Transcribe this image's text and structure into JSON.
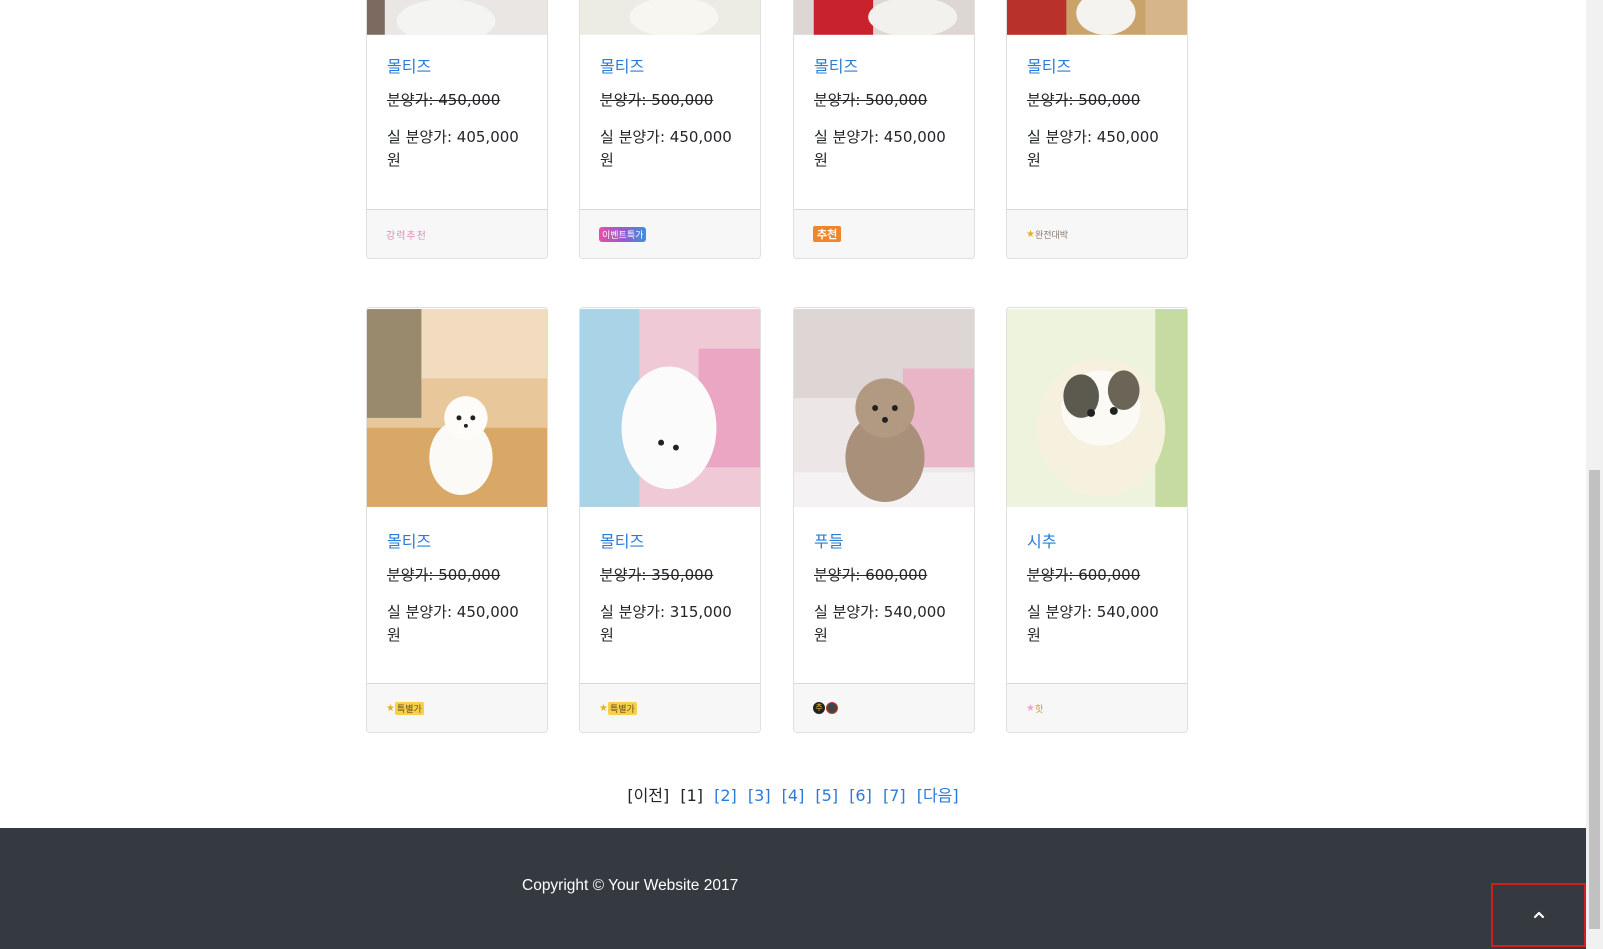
{
  "colors": {
    "link": "#2b7bd6",
    "footer_bg": "#343a40",
    "card_footer_bg": "#f7f7f7",
    "highlight_border": "#d11f1f"
  },
  "cards_row1": [
    {
      "name": "몰티즈",
      "original_price": "분양가: 450,000",
      "real_price": "실 분양가: 405,000 원",
      "badge": "강력추천",
      "badge_icon": "strong-recommend-badge-icon"
    },
    {
      "name": "몰티즈",
      "original_price": "분양가: 500,000",
      "real_price": "실 분양가: 450,000 원",
      "badge": "이벤트특가",
      "badge_icon": "event-badge-icon"
    },
    {
      "name": "몰티즈",
      "original_price": "분양가: 500,000",
      "real_price": "실 분양가: 450,000 원",
      "badge": "추천",
      "badge_icon": "recommend-badge-icon"
    },
    {
      "name": "몰티즈",
      "original_price": "분양가: 500,000",
      "real_price": "실 분양가: 450,000 원",
      "badge": "완전대박",
      "badge_icon": "jackpot-badge-icon"
    }
  ],
  "cards_row2": [
    {
      "name": "몰티즈",
      "original_price": "분양가: 500,000",
      "real_price": "실 분양가: 450,000 원",
      "badge": "특별가",
      "badge_icon": "special-price-badge-icon",
      "image": "white-puppy-wood-floor-photo"
    },
    {
      "name": "몰티즈",
      "original_price": "분양가: 350,000",
      "real_price": "실 분양가: 315,000 원",
      "badge": "특별가",
      "badge_icon": "special-price-badge-icon",
      "image": "white-puppy-pink-sofa-photo"
    },
    {
      "name": "푸들",
      "original_price": "분양가: 600,000",
      "real_price": "실 분양가: 540,000 원",
      "badge": "추천",
      "badge_icon": "circle-badge-icon",
      "image": "brown-poodle-photo"
    },
    {
      "name": "시추",
      "original_price": "분양가: 600,000",
      "real_price": "실 분양가: 540,000 원",
      "badge": "핫",
      "badge_icon": "hot-badge-icon",
      "image": "shih-tzu-puppy-photo"
    }
  ],
  "pagination": {
    "prev": "[이전]",
    "current": "[1]",
    "pages": [
      "[2]",
      "[3]",
      "[4]",
      "[5]",
      "[6]",
      "[7]"
    ],
    "next": "[다음]"
  },
  "footer": {
    "copyright": "Copyright © Your Website 2017"
  },
  "scroll_top": {
    "icon": "chevron-up-icon"
  }
}
